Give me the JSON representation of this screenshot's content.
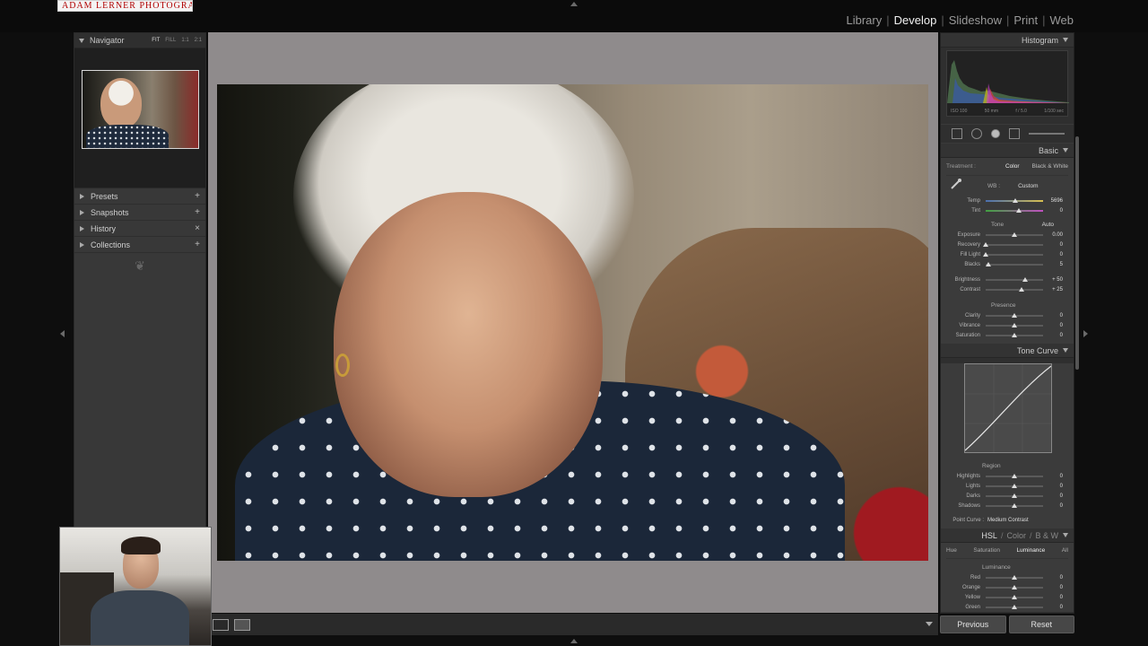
{
  "logo_text": "ADAM LERNER PHOTOGRAPHY",
  "modules": [
    {
      "label": "Library",
      "active": false
    },
    {
      "label": "Develop",
      "active": true
    },
    {
      "label": "Slideshow",
      "active": false
    },
    {
      "label": "Print",
      "active": false
    },
    {
      "label": "Web",
      "active": false
    }
  ],
  "navigator": {
    "title": "Navigator",
    "zoom_options": [
      "FIT",
      "FILL",
      "1:1",
      "2:1"
    ],
    "zoom_selected": "FIT"
  },
  "left_sections": [
    {
      "label": "Presets",
      "action": "+"
    },
    {
      "label": "Snapshots",
      "action": "+"
    },
    {
      "label": "History",
      "action": "×"
    },
    {
      "label": "Collections",
      "action": "+"
    }
  ],
  "histogram": {
    "title": "Histogram",
    "iso": "ISO 100",
    "focal": "50 mm",
    "aperture": "f / 5.0",
    "shutter": "1/100 sec"
  },
  "basic": {
    "title": "Basic",
    "treatment_label": "Treatment :",
    "treatment_color": "Color",
    "treatment_bw": "Black & White",
    "wb_label": "WB :",
    "wb_value": "Custom",
    "temp": {
      "label": "Temp",
      "value": "5696",
      "level": 0.52
    },
    "tint": {
      "label": "Tint",
      "value": "0",
      "level": 0.58
    },
    "tone_label": "Tone",
    "auto_label": "Auto",
    "tone": [
      {
        "label": "Exposure",
        "value": "0.00",
        "level": 0.5
      },
      {
        "label": "Recovery",
        "value": "0",
        "level": 0.0
      },
      {
        "label": "Fill Light",
        "value": "0",
        "level": 0.0
      },
      {
        "label": "Blacks",
        "value": "5",
        "level": 0.05
      }
    ],
    "tone2": [
      {
        "label": "Brightness",
        "value": "+ 50",
        "level": 0.69
      },
      {
        "label": "Contrast",
        "value": "+ 25",
        "level": 0.62
      }
    ],
    "presence_label": "Presence",
    "presence": [
      {
        "label": "Clarity",
        "value": "0",
        "level": 0.5
      },
      {
        "label": "Vibrance",
        "value": "0",
        "level": 0.5
      },
      {
        "label": "Saturation",
        "value": "0",
        "level": 0.5
      }
    ]
  },
  "tone_curve": {
    "title": "Tone Curve",
    "region_label": "Region",
    "regions": [
      {
        "label": "Highlights",
        "value": "0",
        "level": 0.5
      },
      {
        "label": "Lights",
        "value": "0",
        "level": 0.5
      },
      {
        "label": "Darks",
        "value": "0",
        "level": 0.5
      },
      {
        "label": "Shadows",
        "value": "0",
        "level": 0.5
      }
    ],
    "point_curve_label": "Point Curve :",
    "point_curve_value": "Medium Contrast"
  },
  "hsl": {
    "title_hsl": "HSL",
    "title_color": "Color",
    "title_bw": "B & W",
    "tabs": [
      {
        "label": "Hue",
        "active": false
      },
      {
        "label": "Saturation",
        "active": false
      },
      {
        "label": "Luminance",
        "active": true
      },
      {
        "label": "All",
        "active": false
      }
    ],
    "section_label": "Luminance",
    "rows": [
      {
        "label": "Red",
        "value": "0",
        "level": 0.5
      },
      {
        "label": "Orange",
        "value": "0",
        "level": 0.5
      },
      {
        "label": "Yellow",
        "value": "0",
        "level": 0.5
      },
      {
        "label": "Green",
        "value": "0",
        "level": 0.5
      }
    ]
  },
  "buttons": {
    "previous": "Previous",
    "reset": "Reset"
  }
}
